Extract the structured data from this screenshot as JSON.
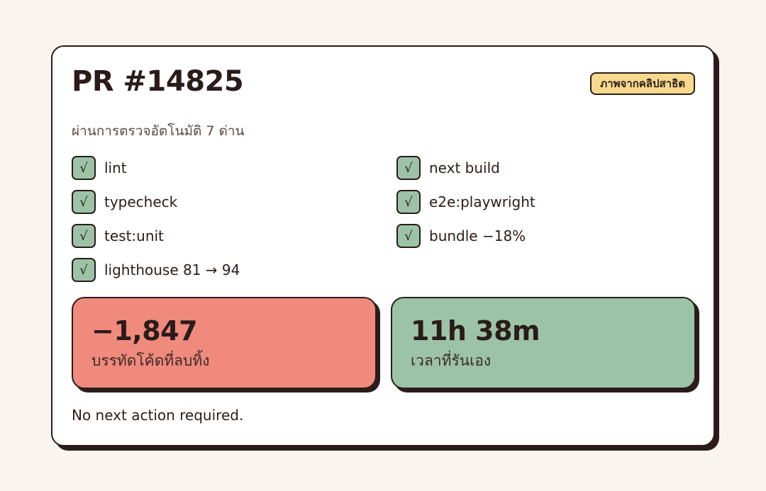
{
  "header": {
    "title": "PR #14825",
    "badge": "ภาพจากคลิปสาธิต"
  },
  "subtitle": "ผ่านการตรวจอัตโนมัติ 7 ด่าน",
  "checks": [
    {
      "label": "lint",
      "mark": "√"
    },
    {
      "label": "typecheck",
      "mark": "√"
    },
    {
      "label": "test:unit",
      "mark": "√"
    },
    {
      "label": "lighthouse 81 → 94",
      "mark": "√"
    },
    {
      "label": "next build",
      "mark": "√"
    },
    {
      "label": "e2e:playwright",
      "mark": "√"
    },
    {
      "label": "bundle −18%",
      "mark": "√"
    }
  ],
  "stats": {
    "lines_deleted": {
      "value": "−1,847",
      "label": "บรรทัดโค้ดที่ลบทิ้ง",
      "color": "#f08a7d"
    },
    "run_time": {
      "value": "11h 38m",
      "label": "เวลาที่รันเอง",
      "color": "#9dc3a7"
    }
  },
  "footer": "No next action required.",
  "colors": {
    "background": "#f9f4ee",
    "ink": "#2a1c1a",
    "badge": "#f6d98d",
    "check": "#9dc3a7"
  }
}
